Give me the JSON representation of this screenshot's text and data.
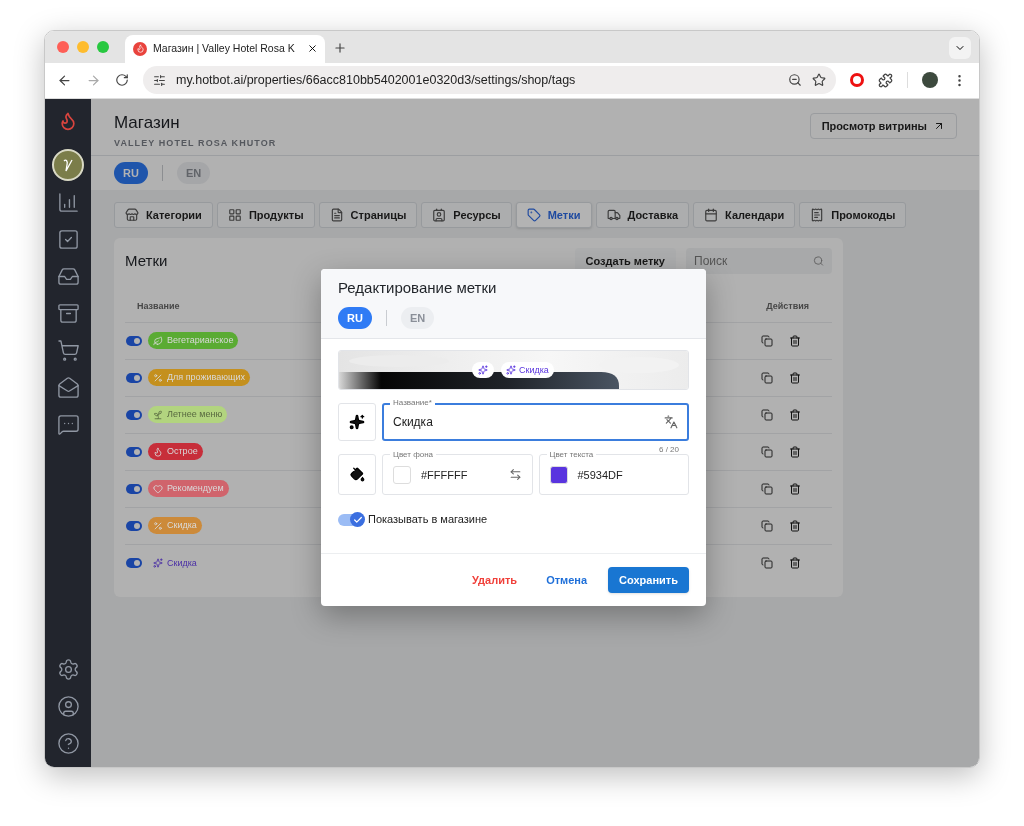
{
  "browser": {
    "tab_title": "Магазин | Valley Hotel Rosa K",
    "url": "my.hotbot.ai/properties/66acc810bb5402001e0320d3/settings/shop/tags"
  },
  "page": {
    "title": "Магазин",
    "subtitle": "VALLEY HOTEL ROSA KHUTOR",
    "storefront_button": "Просмотр витрины",
    "languages": [
      {
        "label": "RU",
        "selected": true
      },
      {
        "label": "EN",
        "selected": false
      }
    ],
    "tabs": [
      {
        "label": "Категории",
        "selected": false
      },
      {
        "label": "Продукты",
        "selected": false
      },
      {
        "label": "Страницы",
        "selected": false
      },
      {
        "label": "Ресурсы",
        "selected": false
      },
      {
        "label": "Метки",
        "selected": true
      },
      {
        "label": "Доставка",
        "selected": false
      },
      {
        "label": "Календари",
        "selected": false
      },
      {
        "label": "Промокоды",
        "selected": false
      }
    ]
  },
  "tags_panel": {
    "title": "Метки",
    "create_button": "Создать метку",
    "search": {
      "placeholder": "Поиск"
    },
    "columns": [
      "Название",
      "Действия"
    ],
    "rows": [
      {
        "label": "Вегетарианское",
        "enabled": true,
        "kind": "filled",
        "color": "#5aab33"
      },
      {
        "label": "Для проживающих",
        "enabled": true,
        "kind": "filled",
        "color": "#c4901e"
      },
      {
        "label": "Летнее меню",
        "enabled": true,
        "kind": "soft",
        "color": "#b2d47f"
      },
      {
        "label": "Острое",
        "enabled": true,
        "kind": "filled",
        "color": "#c72e3a"
      },
      {
        "label": "Рекомендуем",
        "enabled": true,
        "kind": "filled",
        "color": "#d0646c"
      },
      {
        "label": "Скидка",
        "enabled": true,
        "kind": "filled",
        "color": "#cc8a3a"
      },
      {
        "label": "Скидка",
        "enabled": true,
        "kind": "plain",
        "color": "#4a2fa6"
      }
    ]
  },
  "dialog": {
    "title": "Редактирование метки",
    "languages": [
      {
        "label": "RU",
        "selected": true
      },
      {
        "label": "EN",
        "selected": false
      }
    ],
    "preview_chip": "Скидка",
    "name_field": {
      "label": "Название*",
      "value": "Скидка",
      "counter": "6 / 20"
    },
    "background_field": {
      "label": "Цвет фона",
      "value": "#FFFFFF",
      "color": "#ffffff"
    },
    "text_color_field": {
      "label": "Цвет текста",
      "value": "#5934DF",
      "color": "#5934df"
    },
    "show_in_store": {
      "label": "Показывать в магазине",
      "checked": true
    },
    "buttons": [
      {
        "label": "Удалить",
        "kind": "danger"
      },
      {
        "label": "Отмена",
        "kind": "text"
      },
      {
        "label": "Сохранить",
        "kind": "primary"
      }
    ]
  }
}
